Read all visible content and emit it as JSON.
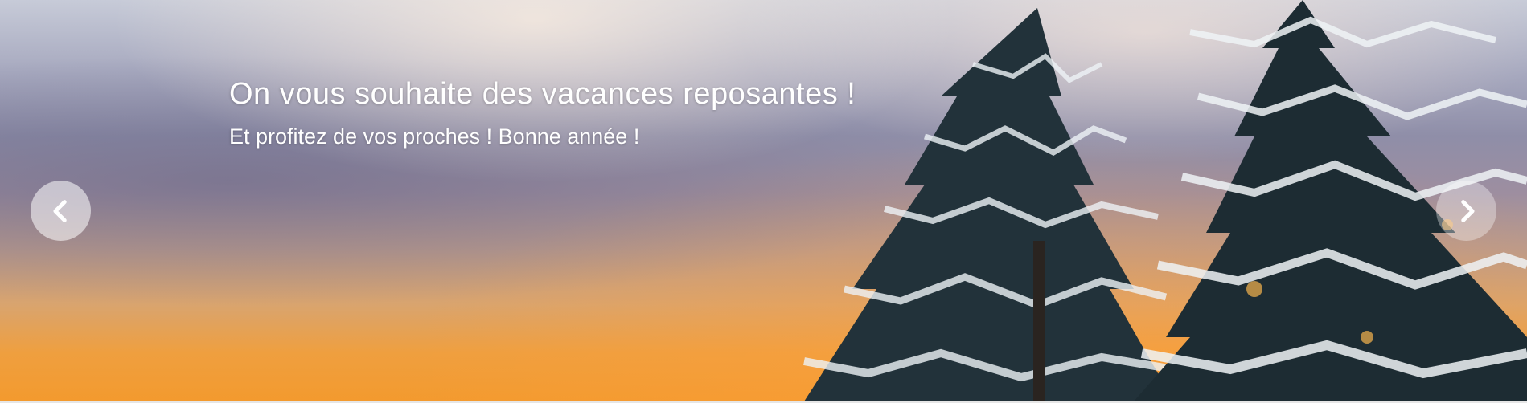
{
  "slide": {
    "title": "On vous souhaite des vacances reposantes !",
    "subtitle": "Et profitez de vos proches ! Bonne année !"
  },
  "controls": {
    "prev_icon": "chevron-left-icon",
    "next_icon": "chevron-right-icon"
  },
  "colors": {
    "sky_top": "#c7cbd8",
    "sky_middle": "#8f8ea8",
    "sunset": "#f39a2e",
    "tree_dark": "#1f2e33",
    "snow": "#eef3f6",
    "caption_text": "#ffffff"
  }
}
